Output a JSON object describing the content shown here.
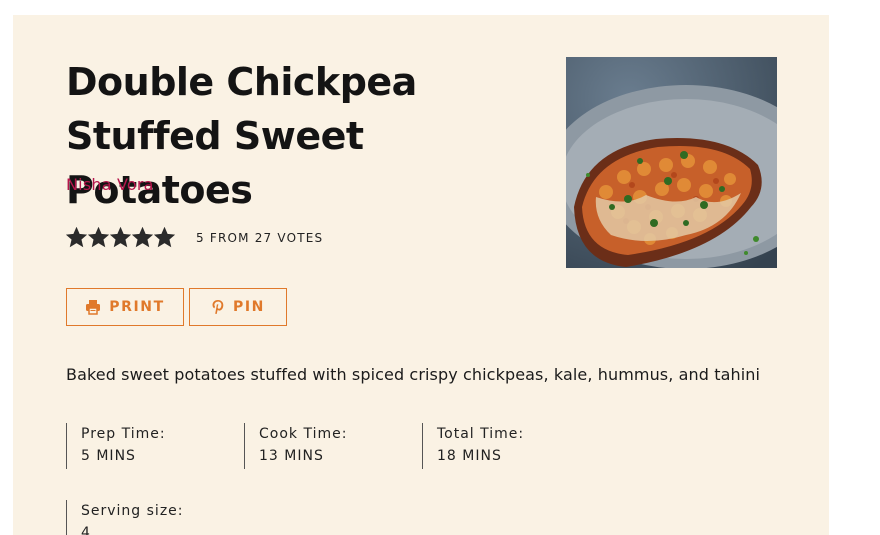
{
  "recipe": {
    "title": "Double Chickpea Stuffed Sweet Potatoes",
    "author": "Nisha Vora",
    "rating": {
      "stars": 5,
      "max_stars": 5,
      "text": "5 FROM 27 VOTES"
    },
    "buttons": {
      "print_label": "PRINT",
      "pin_label": "PIN"
    },
    "summary": "Baked sweet potatoes stuffed with spiced crispy chickpeas, kale, hummus, and tahini",
    "times": {
      "prep_label": "Prep Time:",
      "prep_value": "5 MINS",
      "cook_label": "Cook Time:",
      "cook_value": "13 MINS",
      "total_label": "Total Time:",
      "total_value": "18 MINS"
    },
    "serving": {
      "label": "Serving size:",
      "value": "4"
    }
  },
  "colors": {
    "card_background": "#faf2e4",
    "author": "#b5174c",
    "accent": "#e0792b",
    "star": "#2b2b2b"
  },
  "icons": {
    "print": "printer-icon",
    "pin": "pinterest-icon",
    "star": "star-icon"
  }
}
